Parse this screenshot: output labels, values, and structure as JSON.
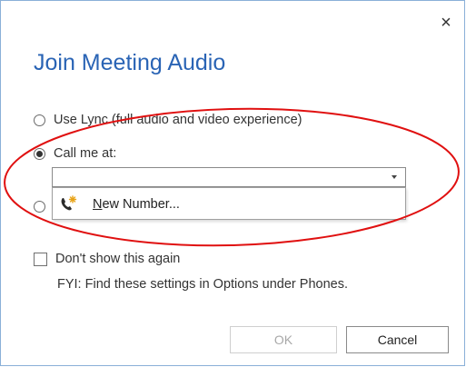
{
  "dialog": {
    "title": "Join Meeting Audio",
    "close_label": "×",
    "options": [
      {
        "label": "Use Lync (full audio and video experience)",
        "checked": false
      },
      {
        "label": "Call me at:",
        "checked": true
      }
    ],
    "call_me_select": {
      "value": ""
    },
    "dropdown_items": [
      {
        "accel": "N",
        "label_rest": "ew Number...",
        "icon": "phone-new-number-icon"
      }
    ],
    "dont_show_label": "Don't show this again",
    "fyi_text": "FYI: Find these settings in Options under Phones.",
    "ok_label": "OK",
    "cancel_label": "Cancel"
  },
  "colors": {
    "title": "#2a64b5",
    "annotation_ellipse": "#e01010",
    "border": "#8ab0d8"
  }
}
